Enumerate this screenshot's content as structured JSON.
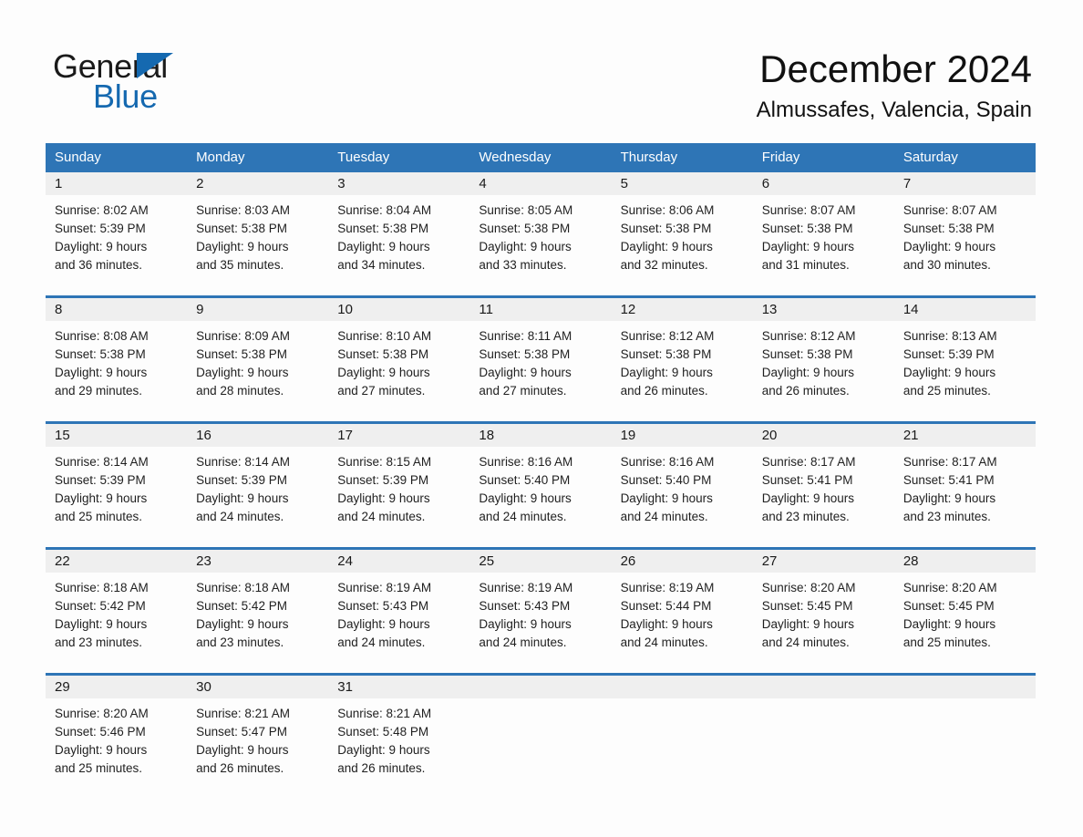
{
  "brand": {
    "name_part1": "General",
    "name_part2": "Blue",
    "triangle_color": "#1569b0",
    "accent_color": "#2e75b6"
  },
  "header": {
    "title": "December 2024",
    "subtitle": "Almussafes, Valencia, Spain"
  },
  "calendar": {
    "weekdays": [
      "Sunday",
      "Monday",
      "Tuesday",
      "Wednesday",
      "Thursday",
      "Friday",
      "Saturday"
    ],
    "weeks": [
      [
        {
          "day": "1",
          "sunrise": "Sunrise: 8:02 AM",
          "sunset": "Sunset: 5:39 PM",
          "daylight1": "Daylight: 9 hours",
          "daylight2": "and 36 minutes."
        },
        {
          "day": "2",
          "sunrise": "Sunrise: 8:03 AM",
          "sunset": "Sunset: 5:38 PM",
          "daylight1": "Daylight: 9 hours",
          "daylight2": "and 35 minutes."
        },
        {
          "day": "3",
          "sunrise": "Sunrise: 8:04 AM",
          "sunset": "Sunset: 5:38 PM",
          "daylight1": "Daylight: 9 hours",
          "daylight2": "and 34 minutes."
        },
        {
          "day": "4",
          "sunrise": "Sunrise: 8:05 AM",
          "sunset": "Sunset: 5:38 PM",
          "daylight1": "Daylight: 9 hours",
          "daylight2": "and 33 minutes."
        },
        {
          "day": "5",
          "sunrise": "Sunrise: 8:06 AM",
          "sunset": "Sunset: 5:38 PM",
          "daylight1": "Daylight: 9 hours",
          "daylight2": "and 32 minutes."
        },
        {
          "day": "6",
          "sunrise": "Sunrise: 8:07 AM",
          "sunset": "Sunset: 5:38 PM",
          "daylight1": "Daylight: 9 hours",
          "daylight2": "and 31 minutes."
        },
        {
          "day": "7",
          "sunrise": "Sunrise: 8:07 AM",
          "sunset": "Sunset: 5:38 PM",
          "daylight1": "Daylight: 9 hours",
          "daylight2": "and 30 minutes."
        }
      ],
      [
        {
          "day": "8",
          "sunrise": "Sunrise: 8:08 AM",
          "sunset": "Sunset: 5:38 PM",
          "daylight1": "Daylight: 9 hours",
          "daylight2": "and 29 minutes."
        },
        {
          "day": "9",
          "sunrise": "Sunrise: 8:09 AM",
          "sunset": "Sunset: 5:38 PM",
          "daylight1": "Daylight: 9 hours",
          "daylight2": "and 28 minutes."
        },
        {
          "day": "10",
          "sunrise": "Sunrise: 8:10 AM",
          "sunset": "Sunset: 5:38 PM",
          "daylight1": "Daylight: 9 hours",
          "daylight2": "and 27 minutes."
        },
        {
          "day": "11",
          "sunrise": "Sunrise: 8:11 AM",
          "sunset": "Sunset: 5:38 PM",
          "daylight1": "Daylight: 9 hours",
          "daylight2": "and 27 minutes."
        },
        {
          "day": "12",
          "sunrise": "Sunrise: 8:12 AM",
          "sunset": "Sunset: 5:38 PM",
          "daylight1": "Daylight: 9 hours",
          "daylight2": "and 26 minutes."
        },
        {
          "day": "13",
          "sunrise": "Sunrise: 8:12 AM",
          "sunset": "Sunset: 5:38 PM",
          "daylight1": "Daylight: 9 hours",
          "daylight2": "and 26 minutes."
        },
        {
          "day": "14",
          "sunrise": "Sunrise: 8:13 AM",
          "sunset": "Sunset: 5:39 PM",
          "daylight1": "Daylight: 9 hours",
          "daylight2": "and 25 minutes."
        }
      ],
      [
        {
          "day": "15",
          "sunrise": "Sunrise: 8:14 AM",
          "sunset": "Sunset: 5:39 PM",
          "daylight1": "Daylight: 9 hours",
          "daylight2": "and 25 minutes."
        },
        {
          "day": "16",
          "sunrise": "Sunrise: 8:14 AM",
          "sunset": "Sunset: 5:39 PM",
          "daylight1": "Daylight: 9 hours",
          "daylight2": "and 24 minutes."
        },
        {
          "day": "17",
          "sunrise": "Sunrise: 8:15 AM",
          "sunset": "Sunset: 5:39 PM",
          "daylight1": "Daylight: 9 hours",
          "daylight2": "and 24 minutes."
        },
        {
          "day": "18",
          "sunrise": "Sunrise: 8:16 AM",
          "sunset": "Sunset: 5:40 PM",
          "daylight1": "Daylight: 9 hours",
          "daylight2": "and 24 minutes."
        },
        {
          "day": "19",
          "sunrise": "Sunrise: 8:16 AM",
          "sunset": "Sunset: 5:40 PM",
          "daylight1": "Daylight: 9 hours",
          "daylight2": "and 24 minutes."
        },
        {
          "day": "20",
          "sunrise": "Sunrise: 8:17 AM",
          "sunset": "Sunset: 5:41 PM",
          "daylight1": "Daylight: 9 hours",
          "daylight2": "and 23 minutes."
        },
        {
          "day": "21",
          "sunrise": "Sunrise: 8:17 AM",
          "sunset": "Sunset: 5:41 PM",
          "daylight1": "Daylight: 9 hours",
          "daylight2": "and 23 minutes."
        }
      ],
      [
        {
          "day": "22",
          "sunrise": "Sunrise: 8:18 AM",
          "sunset": "Sunset: 5:42 PM",
          "daylight1": "Daylight: 9 hours",
          "daylight2": "and 23 minutes."
        },
        {
          "day": "23",
          "sunrise": "Sunrise: 8:18 AM",
          "sunset": "Sunset: 5:42 PM",
          "daylight1": "Daylight: 9 hours",
          "daylight2": "and 23 minutes."
        },
        {
          "day": "24",
          "sunrise": "Sunrise: 8:19 AM",
          "sunset": "Sunset: 5:43 PM",
          "daylight1": "Daylight: 9 hours",
          "daylight2": "and 24 minutes."
        },
        {
          "day": "25",
          "sunrise": "Sunrise: 8:19 AM",
          "sunset": "Sunset: 5:43 PM",
          "daylight1": "Daylight: 9 hours",
          "daylight2": "and 24 minutes."
        },
        {
          "day": "26",
          "sunrise": "Sunrise: 8:19 AM",
          "sunset": "Sunset: 5:44 PM",
          "daylight1": "Daylight: 9 hours",
          "daylight2": "and 24 minutes."
        },
        {
          "day": "27",
          "sunrise": "Sunrise: 8:20 AM",
          "sunset": "Sunset: 5:45 PM",
          "daylight1": "Daylight: 9 hours",
          "daylight2": "and 24 minutes."
        },
        {
          "day": "28",
          "sunrise": "Sunrise: 8:20 AM",
          "sunset": "Sunset: 5:45 PM",
          "daylight1": "Daylight: 9 hours",
          "daylight2": "and 25 minutes."
        }
      ],
      [
        {
          "day": "29",
          "sunrise": "Sunrise: 8:20 AM",
          "sunset": "Sunset: 5:46 PM",
          "daylight1": "Daylight: 9 hours",
          "daylight2": "and 25 minutes."
        },
        {
          "day": "30",
          "sunrise": "Sunrise: 8:21 AM",
          "sunset": "Sunset: 5:47 PM",
          "daylight1": "Daylight: 9 hours",
          "daylight2": "and 26 minutes."
        },
        {
          "day": "31",
          "sunrise": "Sunrise: 8:21 AM",
          "sunset": "Sunset: 5:48 PM",
          "daylight1": "Daylight: 9 hours",
          "daylight2": "and 26 minutes."
        },
        {
          "day": "",
          "sunrise": "",
          "sunset": "",
          "daylight1": "",
          "daylight2": ""
        },
        {
          "day": "",
          "sunrise": "",
          "sunset": "",
          "daylight1": "",
          "daylight2": ""
        },
        {
          "day": "",
          "sunrise": "",
          "sunset": "",
          "daylight1": "",
          "daylight2": ""
        },
        {
          "day": "",
          "sunrise": "",
          "sunset": "",
          "daylight1": "",
          "daylight2": ""
        }
      ]
    ]
  }
}
